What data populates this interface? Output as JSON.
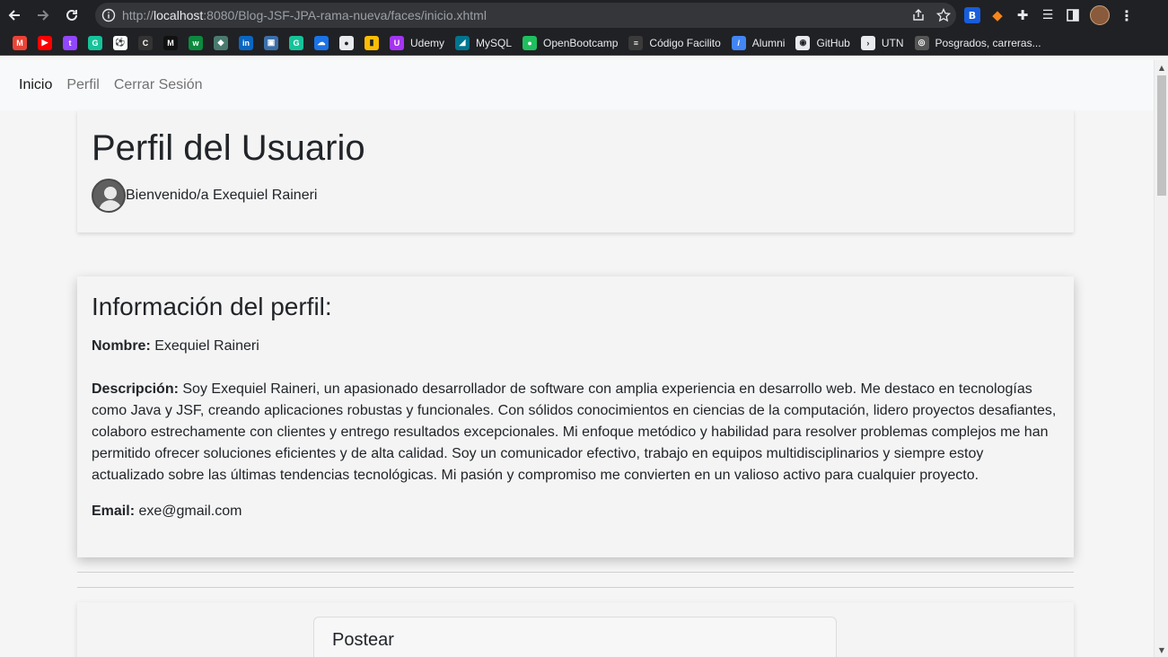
{
  "browser": {
    "url_prefix": "http://",
    "url_host": "localhost",
    "url_rest": ":8080/Blog-JSF-JPA-rama-nueva/faces/inicio.xhtml",
    "bookmarks": [
      {
        "label": "",
        "icon": "gmail-icon",
        "color": "#ea4335",
        "glyph": "M"
      },
      {
        "label": "",
        "icon": "youtube-icon",
        "color": "#ff0000",
        "glyph": "▶"
      },
      {
        "label": "",
        "icon": "twitch-icon",
        "color": "#9146ff",
        "glyph": "t"
      },
      {
        "label": "",
        "icon": "grammarly-icon",
        "color": "#15c39a",
        "glyph": "G"
      },
      {
        "label": "",
        "icon": "soccer-icon",
        "color": "#ffffff",
        "glyph": "⚽"
      },
      {
        "label": "",
        "icon": "coder-icon",
        "color": "#333333",
        "glyph": "C"
      },
      {
        "label": "",
        "icon": "m-icon",
        "color": "#111111",
        "glyph": "M"
      },
      {
        "label": "",
        "icon": "w-icon",
        "color": "#0b8a3e",
        "glyph": "w"
      },
      {
        "label": "",
        "icon": "ethereum-icon",
        "color": "#4a7a6f",
        "glyph": "◆"
      },
      {
        "label": "",
        "icon": "linkedin-icon",
        "color": "#0a66c2",
        "glyph": "in"
      },
      {
        "label": "",
        "icon": "profile-photo-icon",
        "color": "#3b6fa8",
        "glyph": "▣"
      },
      {
        "label": "",
        "icon": "grammarly2-icon",
        "color": "#15c39a",
        "glyph": "G"
      },
      {
        "label": "",
        "icon": "cloud-icon",
        "color": "#1a73e8",
        "glyph": "☁"
      },
      {
        "label": "",
        "icon": "globe-icon",
        "color": "#e8eaed",
        "glyph": "●"
      },
      {
        "label": "",
        "icon": "note-icon",
        "color": "#fbbc04",
        "glyph": "▮"
      },
      {
        "label": "Udemy",
        "icon": "udemy-icon",
        "color": "#a435f0",
        "glyph": "U"
      },
      {
        "label": "MySQL",
        "icon": "mysql-icon",
        "color": "#00758f",
        "glyph": "◢"
      },
      {
        "label": "OpenBootcamp",
        "icon": "openbootcamp-icon",
        "color": "#1fbf5f",
        "glyph": "●"
      },
      {
        "label": "Código Facilito",
        "icon": "codigofacilito-icon",
        "color": "#3a3a3a",
        "glyph": "≡"
      },
      {
        "label": "Alumni",
        "icon": "alumni-icon",
        "color": "#4285f4",
        "glyph": "/"
      },
      {
        "label": "GitHub",
        "icon": "github-icon",
        "color": "#e8eaed",
        "glyph": "◉"
      },
      {
        "label": "UTN",
        "icon": "terminal-icon",
        "color": "#e8eaed",
        "glyph": "›"
      },
      {
        "label": "Posgrados, carreras...",
        "icon": "posgrados-icon",
        "color": "#555555",
        "glyph": "◎"
      }
    ]
  },
  "navbar": {
    "items": [
      "Inicio",
      "Perfil",
      "Cerrar Sesión"
    ]
  },
  "header": {
    "title": "Perfil del Usuario",
    "welcome": "Bienvenido/a Exequiel Raineri"
  },
  "profile": {
    "heading": "Información del perfil:",
    "name_label": "Nombre:",
    "name_value": "Exequiel Raineri",
    "desc_label": "Descripción:",
    "desc_value": "Soy Exequiel Raineri, un apasionado desarrollador de software con amplia experiencia en desarrollo web. Me destaco en tecnologías como Java y JSF, creando aplicaciones robustas y funcionales. Con sólidos conocimientos en ciencias de la computación, lidero proyectos desafiantes, colaboro estrechamente con clientes y entrego resultados excepcionales. Mi enfoque metódico y habilidad para resolver problemas complejos me han permitido ofrecer soluciones eficientes y de alta calidad. Soy un comunicador efectivo, trabajo en equipos multidisciplinarios y siempre estoy actualizado sobre las últimas tendencias tecnológicas. Mi pasión y compromiso me convierten en un valioso activo para cualquier proyecto.",
    "email_label": "Email:",
    "email_value": "exe@gmail.com"
  },
  "post": {
    "title": "Postear"
  }
}
